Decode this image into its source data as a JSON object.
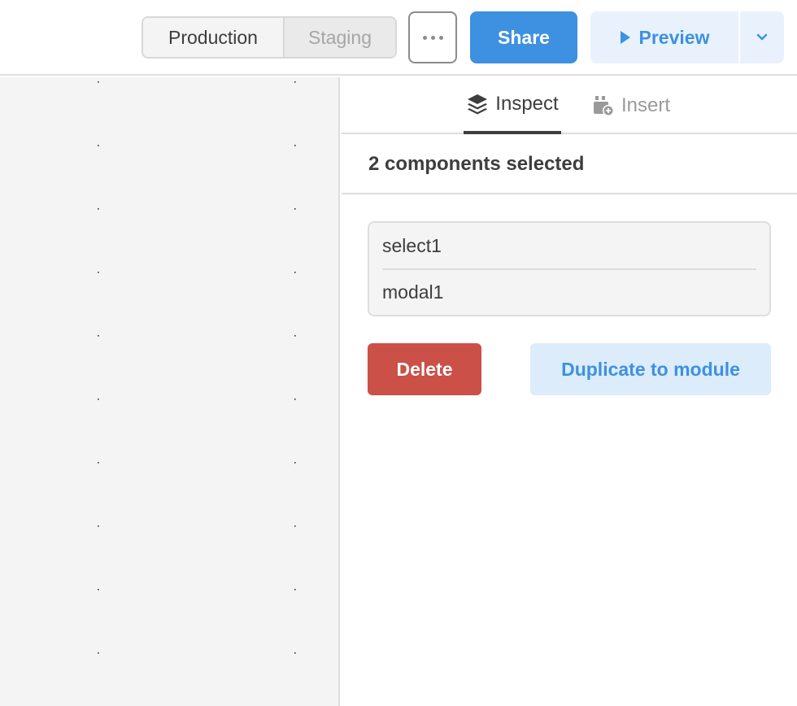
{
  "toolbar": {
    "environments": [
      {
        "label": "Production",
        "state": "active"
      },
      {
        "label": "Staging",
        "state": "inactive"
      }
    ],
    "more_icon": "more-horizontal-icon",
    "share_label": "Share",
    "preview_label": "Preview",
    "preview_icon": "play-icon",
    "dropdown_icon": "chevron-down-icon"
  },
  "panel": {
    "tabs": [
      {
        "label": "Inspect",
        "icon": "layers-icon",
        "active": true
      },
      {
        "label": "Insert",
        "icon": "insert-component-icon",
        "active": false
      }
    ],
    "selection_title": "2 components selected",
    "components": [
      "select1",
      "modal1"
    ],
    "delete_label": "Delete",
    "duplicate_label": "Duplicate to module"
  },
  "colors": {
    "accent": "#3d91e0",
    "danger": "#cb5048",
    "preview_bg": "#e9f2fc",
    "duplicate_bg": "#dcecfb",
    "canvas_bg": "#f4f4f4"
  }
}
